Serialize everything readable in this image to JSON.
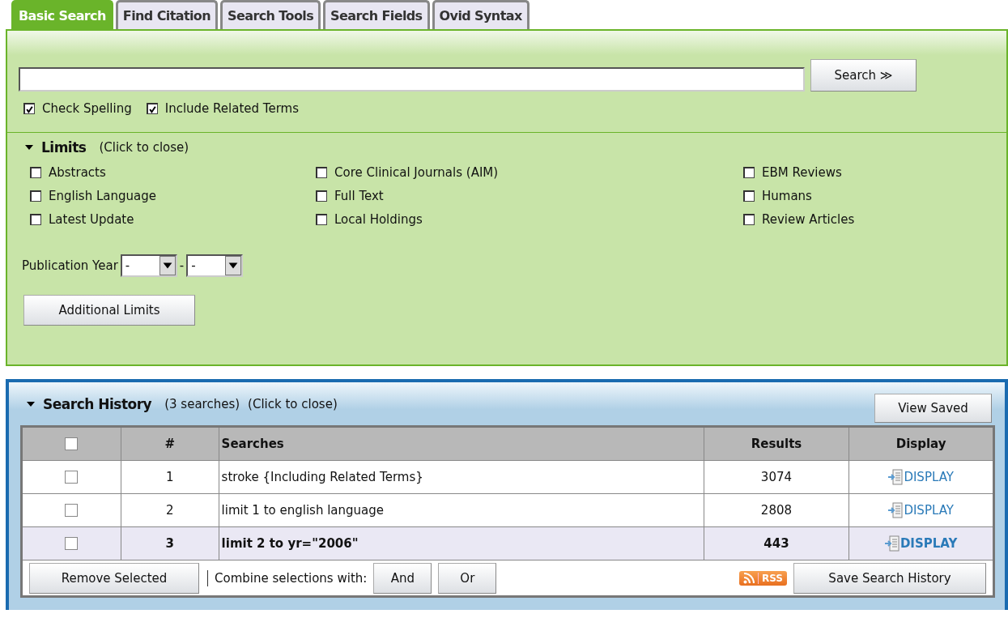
{
  "tabs": [
    {
      "label": "Basic Search",
      "selected": true
    },
    {
      "label": "Find Citation",
      "selected": false
    },
    {
      "label": "Search Tools",
      "selected": false
    },
    {
      "label": "Search Fields",
      "selected": false
    },
    {
      "label": "Ovid Syntax",
      "selected": false
    }
  ],
  "search": {
    "button": "Search",
    "button_icon": "≫",
    "options": [
      {
        "label": "Check Spelling",
        "checked": true
      },
      {
        "label": "Include Related Terms",
        "checked": true
      }
    ]
  },
  "limits": {
    "title": "Limits",
    "hint": "(Click to close)",
    "expanded": true,
    "columns": [
      [
        {
          "label": "Abstracts",
          "checked": false
        },
        {
          "label": "English Language",
          "checked": false
        },
        {
          "label": "Latest Update",
          "checked": false
        }
      ],
      [
        {
          "label": "Core Clinical Journals (AIM)",
          "checked": false
        },
        {
          "label": "Full Text",
          "checked": false
        },
        {
          "label": "Local Holdings",
          "checked": false
        }
      ],
      [
        {
          "label": "EBM Reviews",
          "checked": false
        },
        {
          "label": "Humans",
          "checked": false
        },
        {
          "label": "Review Articles",
          "checked": false
        }
      ]
    ],
    "publication_year": {
      "label": "Publication Year",
      "from": "-",
      "separator": "-",
      "to": "-"
    },
    "additional_button": "Additional Limits"
  },
  "history": {
    "title": "Search History",
    "count": "(3 searches)",
    "hint": "(Click to close)",
    "expanded": true,
    "view_saved": "View Saved",
    "columns": [
      "#",
      "Searches",
      "Results",
      "Display"
    ],
    "header_checked": false,
    "rows": [
      {
        "checked": false,
        "number": "1",
        "search": "stroke {Including Related Terms}",
        "results": "3074",
        "display": "DISPLAY",
        "current": false
      },
      {
        "checked": false,
        "number": "2",
        "search": "limit 1 to english language",
        "results": "2808",
        "display": "DISPLAY",
        "current": false
      },
      {
        "checked": false,
        "number": "3",
        "search": "limit 2 to yr=\"2006\"",
        "results": "443",
        "display": "DISPLAY",
        "current": true
      }
    ],
    "remove_button": "Remove Selected",
    "combine_label": "Combine selections with:",
    "combine_buttons": [
      "And",
      "Or"
    ],
    "rss": "RSS",
    "save_button": "Save Search History"
  }
}
